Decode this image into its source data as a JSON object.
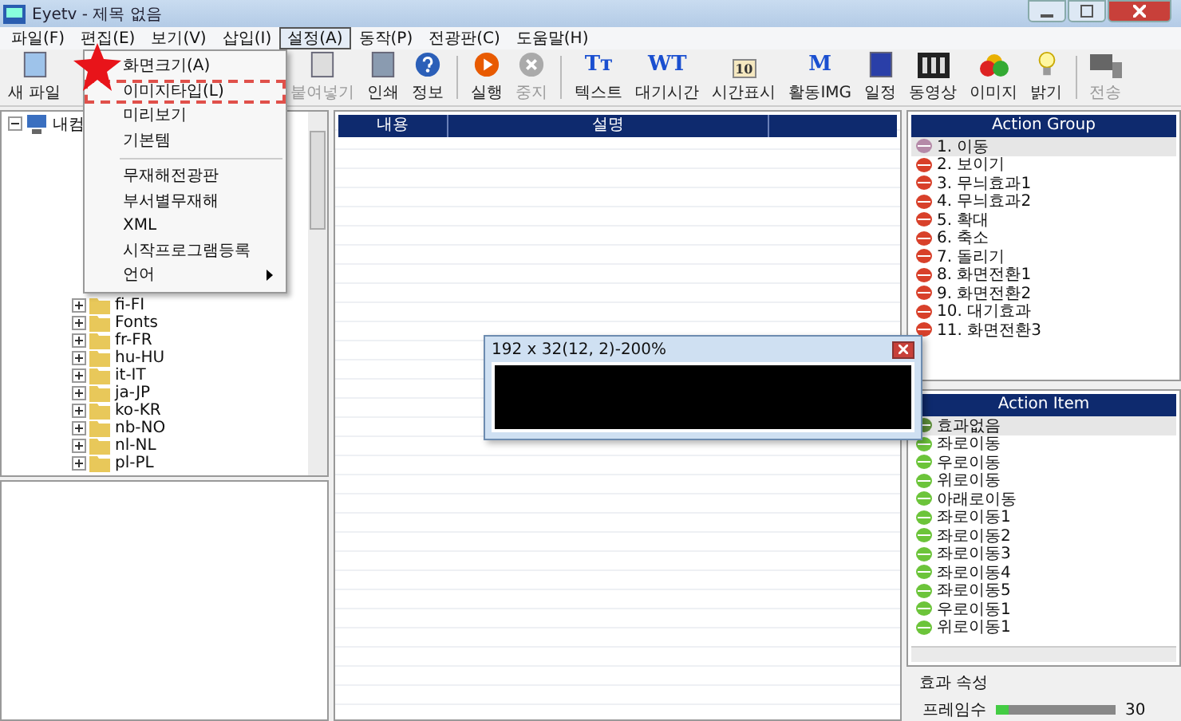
{
  "window": {
    "title": "Eyetv - 제목 없음"
  },
  "menu": [
    {
      "label": "파일(F)",
      "selected": false
    },
    {
      "label": "편집(E)",
      "selected": false
    },
    {
      "label": "보기(V)",
      "selected": false
    },
    {
      "label": "삽입(I)",
      "selected": false
    },
    {
      "label": "설정(A)",
      "selected": true
    },
    {
      "label": "동작(P)",
      "selected": false
    },
    {
      "label": "전광판(C)",
      "selected": false
    },
    {
      "label": "도움말(H)",
      "selected": false
    }
  ],
  "dropdown": [
    {
      "kind": "item",
      "label": "화면크기(A)",
      "annotated": false
    },
    {
      "kind": "item",
      "label": "이미지타입(L)",
      "annotated": true
    },
    {
      "kind": "item",
      "label": "미리보기",
      "annotated": false
    },
    {
      "kind": "item",
      "label": "기본템",
      "annotated": false
    },
    {
      "kind": "separator"
    },
    {
      "kind": "item",
      "label": "무재해전광판",
      "annotated": false
    },
    {
      "kind": "item",
      "label": "부서별무재해",
      "annotated": false
    },
    {
      "kind": "item",
      "label": "XML",
      "annotated": false
    },
    {
      "kind": "item",
      "label": "시작프로그램등록",
      "annotated": false
    },
    {
      "kind": "submenu",
      "label": "언어",
      "annotated": false
    }
  ],
  "toolbar": [
    [
      {
        "kind": "file",
        "label": "새 파일",
        "disabled": false
      }
    ],
    [
      {
        "kind": "paste",
        "label": "붙여넣기",
        "disabled": true
      },
      {
        "kind": "print",
        "label": "인쇄",
        "disabled": false
      },
      {
        "kind": "info",
        "label": "정보",
        "disabled": false
      }
    ],
    [
      {
        "kind": "run",
        "label": "실행",
        "disabled": false
      },
      {
        "kind": "stop",
        "label": "중지",
        "disabled": true
      }
    ],
    [
      {
        "kind": "text",
        "label": "텍스트",
        "glyph": "Tт",
        "disabled": false
      },
      {
        "kind": "text",
        "label": "대기시간",
        "glyph": "WT",
        "disabled": false
      },
      {
        "kind": "clock",
        "label": "시간표시",
        "glyph": "10",
        "disabled": false
      },
      {
        "kind": "text",
        "label": "활동IMG",
        "glyph": "M",
        "disabled": false
      },
      {
        "kind": "schedule",
        "label": "일정",
        "disabled": false
      },
      {
        "kind": "film",
        "label": "동영상",
        "disabled": false
      },
      {
        "kind": "image",
        "label": "이미지",
        "disabled": false
      },
      {
        "kind": "bulb",
        "label": "밝기",
        "disabled": false
      }
    ],
    [
      {
        "kind": "send",
        "label": "전송",
        "disabled": true
      }
    ]
  ],
  "tree": [
    {
      "label": "내컴",
      "expanded": true,
      "children": [
        {
          "label": "fi-FI",
          "expanded": false
        },
        {
          "label": "Fonts",
          "expanded": false
        },
        {
          "label": "fr-FR",
          "expanded": false
        },
        {
          "label": "hu-HU",
          "expanded": false
        },
        {
          "label": "it-IT",
          "expanded": false
        },
        {
          "label": "ja-JP",
          "expanded": false
        },
        {
          "label": "ko-KR",
          "expanded": false
        },
        {
          "label": "nb-NO",
          "expanded": false
        },
        {
          "label": "nl-NL",
          "expanded": false
        },
        {
          "label": "pl-PL",
          "expanded": false
        }
      ]
    }
  ],
  "table": {
    "columns": [
      "내용",
      "설명"
    ]
  },
  "popup": {
    "title": "192 x 32(12, 2)-200%"
  },
  "action_group": {
    "title": "Action Group",
    "items": [
      {
        "label": "1. 이동",
        "selected": true
      },
      {
        "label": "2. 보이기",
        "selected": false
      },
      {
        "label": "3. 무늬효과1",
        "selected": false
      },
      {
        "label": "4. 무늬효과2",
        "selected": false
      },
      {
        "label": "5. 확대",
        "selected": false
      },
      {
        "label": "6. 축소",
        "selected": false
      },
      {
        "label": "7. 돌리기",
        "selected": false
      },
      {
        "label": "8. 화면전환1",
        "selected": false
      },
      {
        "label": "9. 화면전환2",
        "selected": false
      },
      {
        "label": "10. 대기효과",
        "selected": false
      },
      {
        "label": "11. 화면전환3",
        "selected": false
      }
    ]
  },
  "action_item": {
    "title": "Action Item",
    "items": [
      {
        "label": "효과없음",
        "selected": true
      },
      {
        "label": "좌로이동",
        "selected": false
      },
      {
        "label": "우로이동",
        "selected": false
      },
      {
        "label": "위로이동",
        "selected": false
      },
      {
        "label": "아래로이동",
        "selected": false
      },
      {
        "label": "좌로이동1",
        "selected": false
      },
      {
        "label": "좌로이동2",
        "selected": false
      },
      {
        "label": "좌로이동3",
        "selected": false
      },
      {
        "label": "좌로이동4",
        "selected": false
      },
      {
        "label": "좌로이동5",
        "selected": false
      },
      {
        "label": "우로이동1",
        "selected": false
      },
      {
        "label": "위로이동1",
        "selected": false
      }
    ]
  },
  "effect_properties": {
    "title": "효과 속성",
    "frames": {
      "label": "프레임수",
      "level": 0.1,
      "reading": "30"
    }
  }
}
